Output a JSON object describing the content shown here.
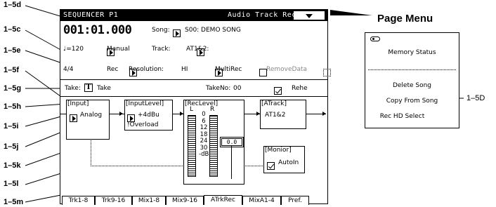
{
  "screen": {
    "title": "SEQUENCER P1",
    "mode": "Audio Track Rec",
    "location": "001:01.000",
    "song_label": "Song:",
    "song_value": "S00: DEMO SONG",
    "tempo": "♩=120",
    "tempo_mode": "Manual",
    "track_label": "Track:",
    "track_value": "AT1&2:",
    "meter": "4/4",
    "rec_mode": "Rec",
    "resolution_label": "Resolution:",
    "resolution_value": "HI",
    "multirec_label": "MultiRec",
    "removedata_label": "RemoveData",
    "take_label": "Take:",
    "take_value": "Take",
    "takeno_label": "TakeNo:",
    "takeno_value": "00",
    "rehe_label": "Rehe",
    "input_title": "[Input]",
    "input_value": "Analog",
    "inputlevel_title": "[InputLevel]",
    "inputlevel_value": "+4dBu",
    "overload_label": "!Overload",
    "reclevel_title": "[RecLevel]",
    "meter_l": "L",
    "meter_r": "R",
    "meter_ticks": [
      "0",
      "6",
      "12",
      "18",
      "24",
      "30",
      "-dB"
    ],
    "fader_value": "0.0",
    "atrack_title": "[ATrack]",
    "atrack_value": "AT1&2",
    "monitor_title": "[Monior]",
    "monitor_value": "AutoIn",
    "tabs": [
      "Trk1-8",
      "Trk9-16",
      "Mix1-8",
      "Mix9-16",
      "ATrkRec",
      "MixA1-4",
      "Pref."
    ]
  },
  "refs": {
    "r1": "1–5d",
    "r2": "1–5c",
    "r3": "1–5e",
    "r4": "1–5f",
    "r5": "1–5g",
    "r6": "1–5h",
    "r7": "1–5i",
    "r8": "1–5j",
    "r9": "1–5k",
    "r10": "1–5l",
    "r11": "1–5m",
    "r12": "1–5D"
  },
  "page_menu": {
    "heading": "Page Menu",
    "items": [
      "Memory Status",
      "Delete Song",
      "Copy From Song",
      "Rec HD Select"
    ]
  }
}
